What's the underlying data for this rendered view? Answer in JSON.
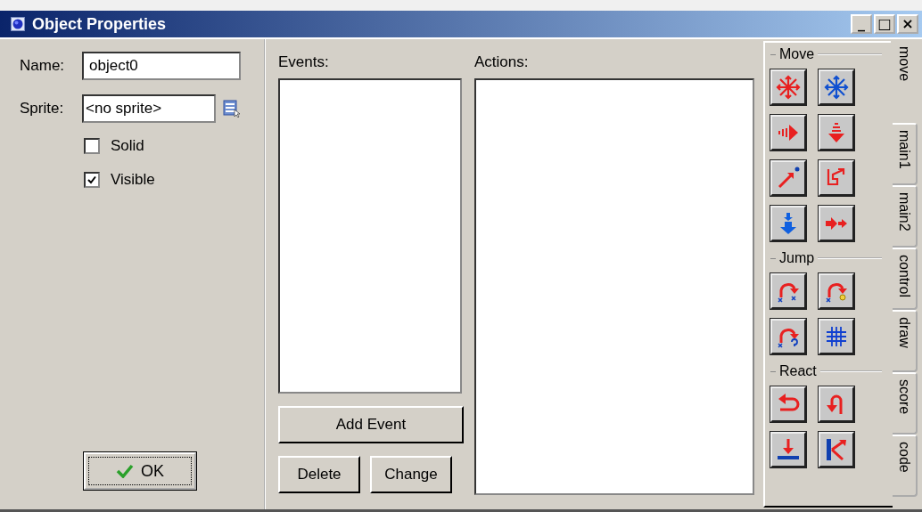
{
  "window": {
    "title": "Object Properties",
    "controls": [
      "_",
      "□",
      "×"
    ]
  },
  "properties": {
    "name": {
      "label": "Name:",
      "value": "object0"
    },
    "sprite": {
      "label": "Sprite:",
      "value": "<no sprite>"
    },
    "checkboxes": [
      {
        "label": "Solid",
        "checked": false
      },
      {
        "label": "Visible",
        "checked": true
      }
    ],
    "ok_button": "OK"
  },
  "events": {
    "label": "Events:",
    "add_button": "Add Event",
    "delete_button": "Delete",
    "change_button": "Change"
  },
  "actions": {
    "label": "Actions:"
  },
  "toolbox": {
    "groups": [
      {
        "label": "Move"
      },
      {
        "label": "Jump"
      },
      {
        "label": "React"
      }
    ]
  },
  "tabs": [
    {
      "label": "move",
      "selected": true
    },
    {
      "label": "main1",
      "selected": false
    },
    {
      "label": "main2",
      "selected": false
    },
    {
      "label": "control",
      "selected": false
    },
    {
      "label": "draw",
      "selected": false
    },
    {
      "label": "score",
      "selected": false
    },
    {
      "label": "code",
      "selected": false
    }
  ]
}
